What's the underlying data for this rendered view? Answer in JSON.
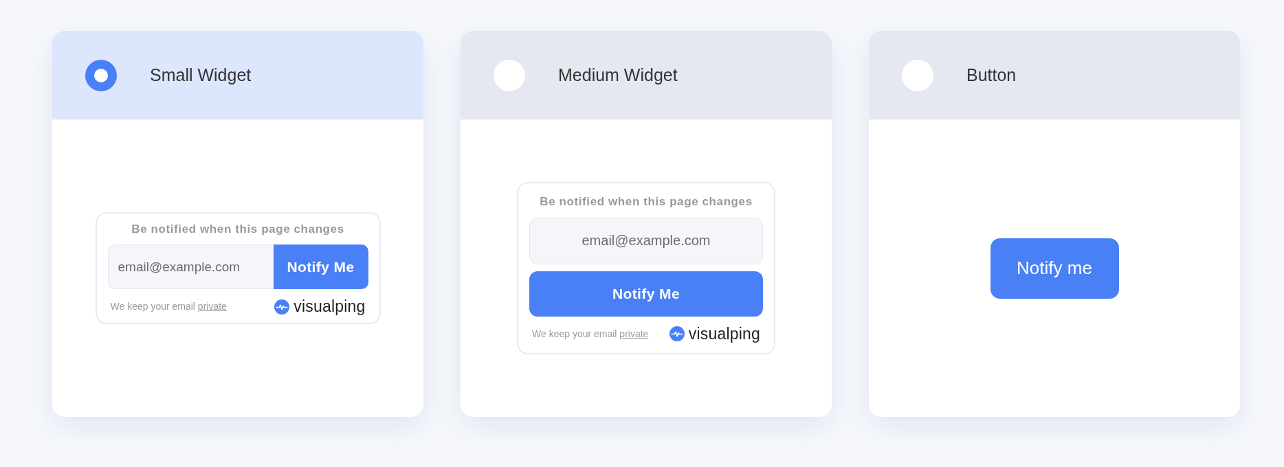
{
  "options": [
    {
      "title": "Small Widget",
      "selected": true,
      "preview": {
        "kind": "small_widget",
        "heading": "Be notified when this page changes",
        "email_placeholder": "email@example.com",
        "button": "Notify Me",
        "privacy_note": "We keep your email",
        "privacy_link": "private",
        "brand": "visualping"
      }
    },
    {
      "title": "Medium Widget",
      "selected": false,
      "preview": {
        "kind": "medium_widget",
        "heading": "Be notified when this page changes",
        "email_placeholder": "email@example.com",
        "button": "Notify Me",
        "privacy_note": "We keep your email",
        "privacy_link": "private",
        "brand": "visualping"
      }
    },
    {
      "title": "Button",
      "selected": false,
      "preview": {
        "kind": "button",
        "button": "Notify me"
      }
    }
  ]
}
